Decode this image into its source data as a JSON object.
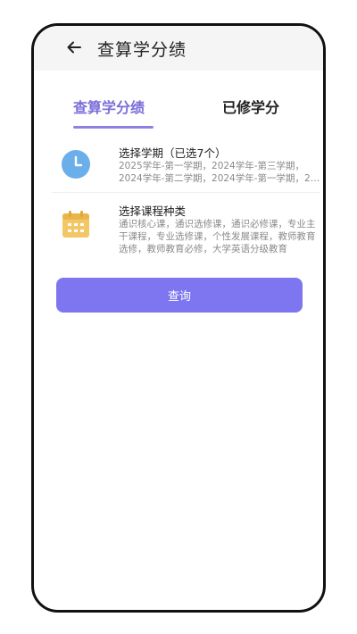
{
  "header": {
    "title": "查算学分绩"
  },
  "tabs": [
    {
      "label": "查算学分绩",
      "active": true
    },
    {
      "label": "已修学分",
      "active": false
    }
  ],
  "semester": {
    "title": "选择学期（已选7个）",
    "line1": "2025学年-第一学期，2024学年-第三学期，",
    "line2": "2024学年-第二学期，2024学年-第一学期，2…"
  },
  "course_types": {
    "title": "选择课程种类",
    "desc": "通识核心课，通识选修课，通识必修课，专业主干课程，专业选修课，个性发展课程，教师教育选修，教师教育必修，大学英语分级教育"
  },
  "query_button": "查询",
  "colors": {
    "accent": "#7b6fd8",
    "button": "#7d76f0",
    "clock_icon": "#6aaeea",
    "calendar_icon": "#f3c766"
  }
}
